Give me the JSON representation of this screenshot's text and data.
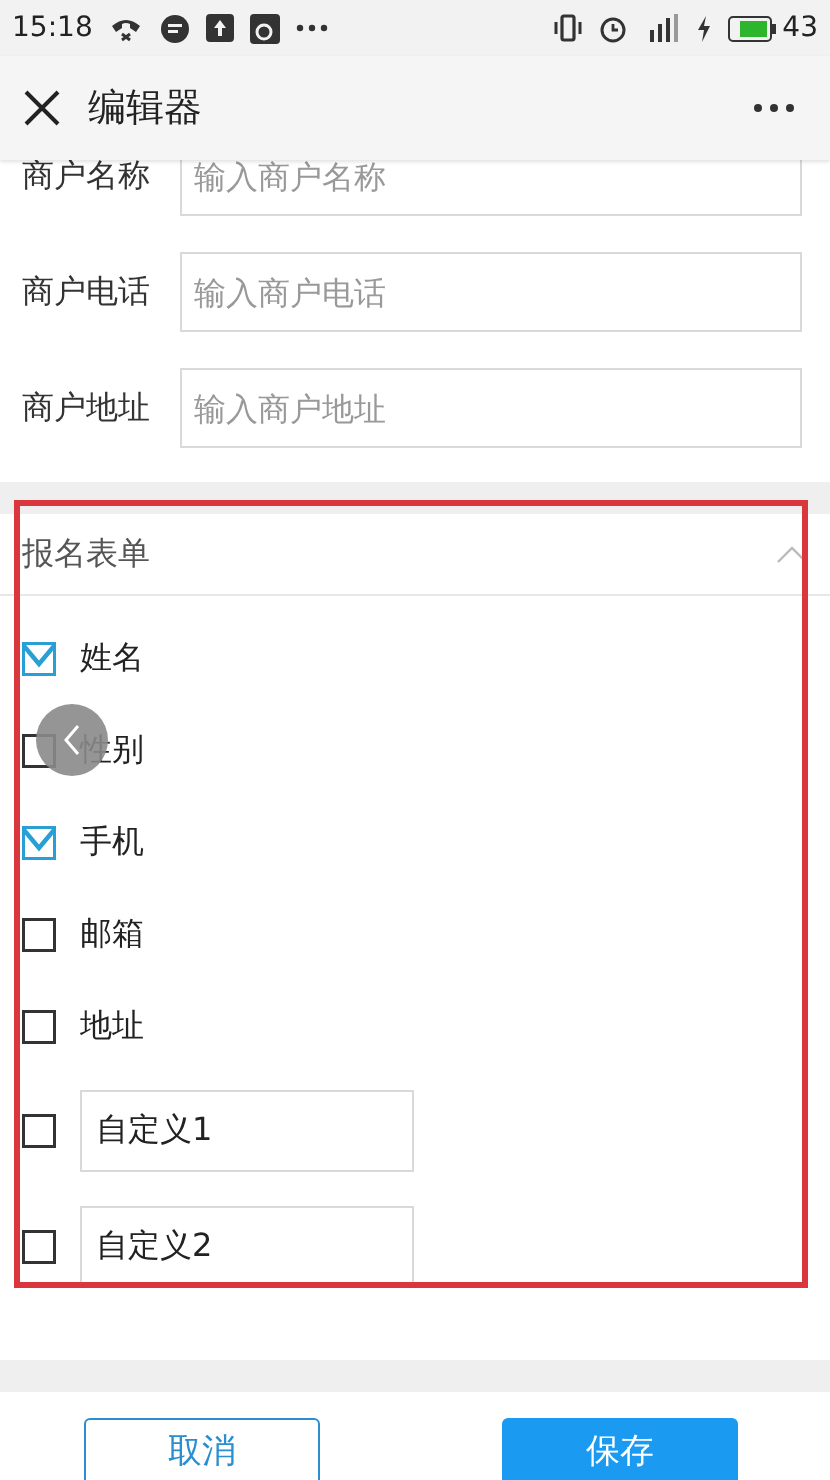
{
  "status_bar": {
    "time": "15:18",
    "battery": "43"
  },
  "header": {
    "title": "编辑器"
  },
  "merchant_fields": [
    {
      "label": "商户名称",
      "placeholder": "输入商户名称",
      "partial": true
    },
    {
      "label": "商户电话",
      "placeholder": "输入商户电话",
      "partial": false
    },
    {
      "label": "商户地址",
      "placeholder": "输入商户地址",
      "partial": false
    }
  ],
  "signup_form": {
    "title": "报名表单",
    "expanded": true,
    "items": [
      {
        "kind": "fixed",
        "label": "姓名",
        "checked": true
      },
      {
        "kind": "fixed",
        "label": "性别",
        "checked": false
      },
      {
        "kind": "fixed",
        "label": "手机",
        "checked": true
      },
      {
        "kind": "fixed",
        "label": "邮箱",
        "checked": false
      },
      {
        "kind": "fixed",
        "label": "地址",
        "checked": false
      },
      {
        "kind": "custom",
        "value": "自定义1",
        "checked": false
      },
      {
        "kind": "custom",
        "value": "自定义2",
        "checked": false
      }
    ]
  },
  "buttons": [
    {
      "kind": "outline",
      "label": "取消"
    },
    {
      "kind": "primary",
      "label": "保存"
    }
  ]
}
